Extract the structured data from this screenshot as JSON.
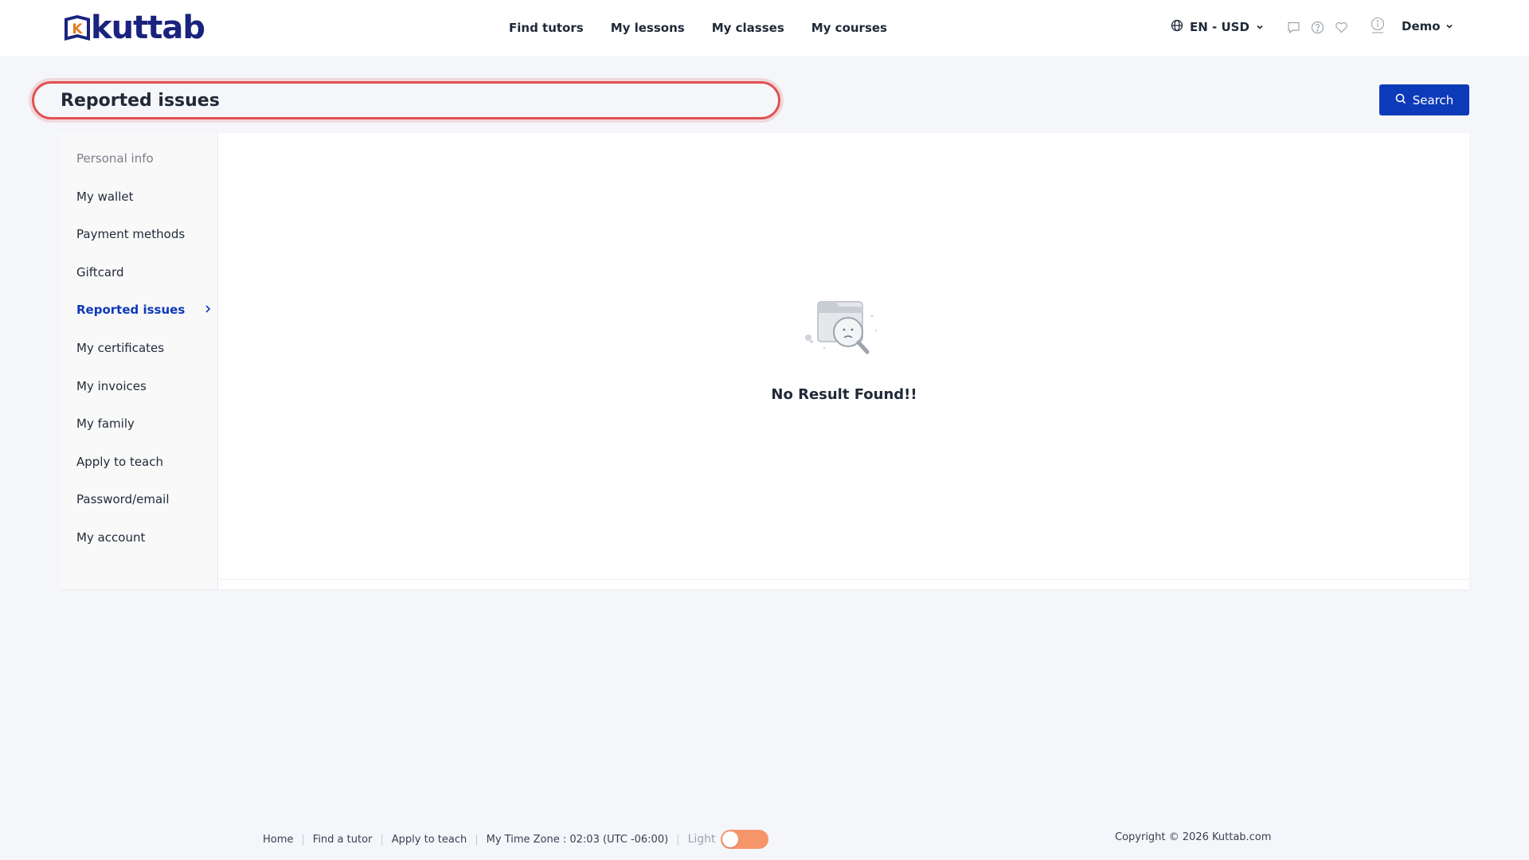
{
  "header": {
    "logo_text": "kuttab",
    "logo_letter": "K",
    "nav": [
      {
        "label": "Find tutors"
      },
      {
        "label": "My lessons"
      },
      {
        "label": "My classes"
      },
      {
        "label": "My courses"
      }
    ],
    "language": "EN - USD",
    "icons": [
      "globe-icon",
      "chat-icon",
      "help-icon",
      "heart-icon",
      "info-icon"
    ],
    "user": "Demo"
  },
  "page": {
    "title": "Reported issues",
    "search_label": "Search"
  },
  "sidebar": {
    "items": [
      {
        "label": "Personal info"
      },
      {
        "label": "My wallet"
      },
      {
        "label": "Payment methods"
      },
      {
        "label": "Giftcard"
      },
      {
        "label": "Reported issues"
      },
      {
        "label": "My certificates"
      },
      {
        "label": "My invoices"
      },
      {
        "label": "My family"
      },
      {
        "label": "Apply to teach"
      },
      {
        "label": "Password/email"
      },
      {
        "label": "My account"
      }
    ],
    "active": "Reported issues"
  },
  "content": {
    "empty_message": "No Result Found!!"
  },
  "footer": {
    "links": [
      {
        "label": "Home"
      },
      {
        "label": "Find a tutor"
      },
      {
        "label": "Apply to teach"
      }
    ],
    "timezone": "My Time Zone : 02:03 (UTC -06:00)",
    "theme_label": "Light",
    "copyright": "Copyright © 2026 Kuttab.com"
  },
  "colors": {
    "brand": "#1a237e",
    "primary": "#0d3ab8",
    "highlight": "#e05252",
    "toggle": "#f7956a"
  }
}
